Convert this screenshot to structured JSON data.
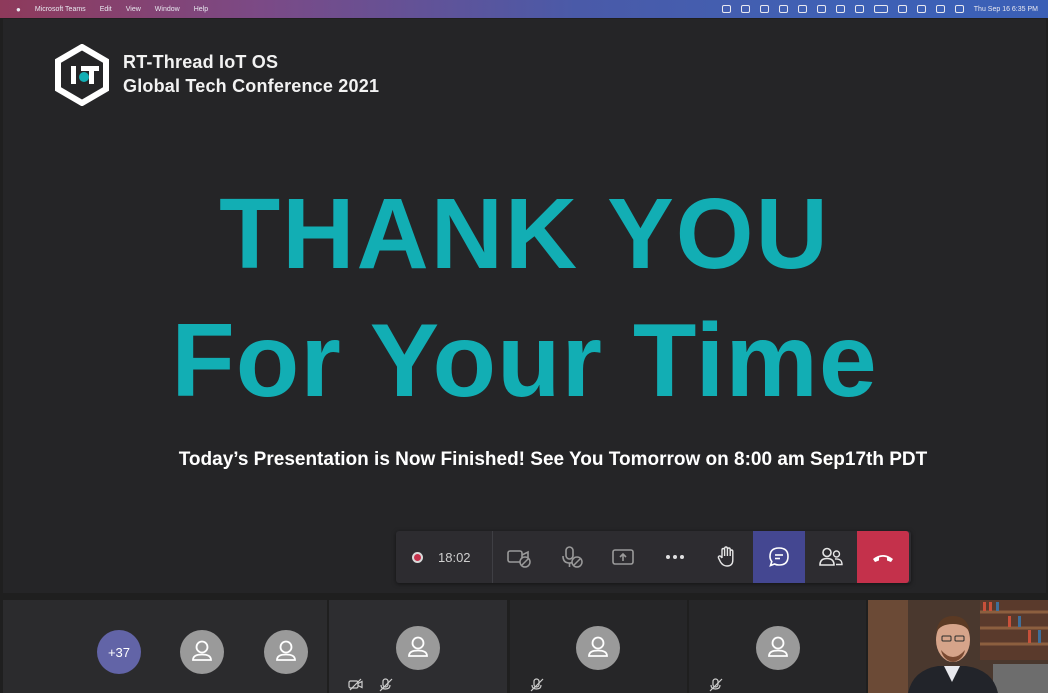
{
  "menubar": {
    "app_name": "Microsoft Teams",
    "menus": [
      "Edit",
      "View",
      "Window",
      "Help"
    ],
    "datetime": "Thu Sep 16  6:35 PM"
  },
  "slide": {
    "brand_line1": "RT-Thread IoT OS",
    "brand_line2": "Global Tech Conference 2021",
    "headline_line1": "THANK YOU",
    "headline_line2": "For Your Time",
    "subtitle": "Today’s Presentation is Now Finished! See You Tomorrow on 8:00 am Sep17th PDT",
    "accent_color": "#12aeb4"
  },
  "toolbar": {
    "timer": "18:02",
    "buttons": [
      "camera-off",
      "mic-off",
      "share-screen",
      "more-actions",
      "raise-hand",
      "chat",
      "participants",
      "hang-up"
    ]
  },
  "participants": {
    "overflow_count": "+37"
  }
}
